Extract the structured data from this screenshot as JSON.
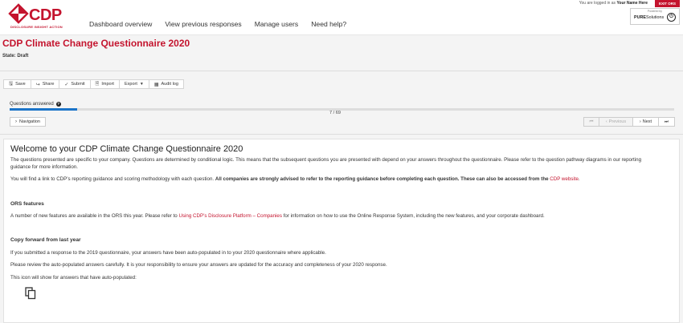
{
  "header": {
    "logo_text": "CDP",
    "logo_tagline": "DISCLOSURE INSIGHT ACTION",
    "nav": [
      "Dashboard overview",
      "View previous responses",
      "Manage users",
      "Need help?"
    ],
    "login_prefix": "You are logged in as",
    "user_name": "Your Name Here",
    "exit_label": "EXIT ORS",
    "powered_by": "Powered by",
    "powered_brand_bold": "PURE",
    "powered_brand_rest": "Solutions"
  },
  "page": {
    "title": "CDP Climate Change Questionnaire 2020",
    "state": "State: Draft"
  },
  "toolbar": {
    "save": "Save",
    "share": "Share",
    "submit": "Submit",
    "import": "Import",
    "export": "Export",
    "audit": "Audit log"
  },
  "progress": {
    "label": "Questions answered",
    "answered": 7,
    "total": 69,
    "count_text": "7 / 69"
  },
  "navigation": {
    "nav_label": "Navigation",
    "previous": "Previous",
    "next": "Next"
  },
  "content": {
    "title": "Welcome to your CDP Climate Change Questionnaire 2020",
    "intro": "The questions presented are specific to your company. Questions are determined by conditional logic. This means that the subsequent questions you are presented with depend on your answers throughout the questionnaire. Please refer to the question pathway diagrams in our reporting guidance for more information.",
    "guidance_pre": "You will find a link to CDP’s reporting guidance and scoring methodology with each question. ",
    "guidance_bold": "All companies are strongly advised to refer to the reporting guidance before completing each question. These can also be accessed from the ",
    "guidance_link": "CDP website",
    "guidance_end": ".",
    "ors_heading": "ORS features",
    "ors_pre": "A number of new features are available in the ORS this year. Please refer to ",
    "ors_link": "Using CDP’s Disclosure Platform – Companies",
    "ors_post": " for information on how to use the Online Response System, including the new features, and your corporate dashboard.",
    "copy_heading": "Copy forward from last year",
    "copy_p1": "If you submitted a response to the 2019  questionnaire, your answers have been auto-populated in to your 2020  questionnaire where applicable.",
    "copy_p2": "Please review the auto-populated answers carefully. It is your responsibility to ensure your answers are updated for the accuracy and completeness of your 2020  response.",
    "copy_p3": "This icon will show for answers that have auto-populated:"
  },
  "colors": {
    "brand": "#c4142e",
    "progress": "#1b74c8"
  },
  "icons": [
    "cdp-logo-icon",
    "save-icon",
    "share-icon",
    "check-icon",
    "import-icon",
    "caret-down-icon",
    "audit-icon",
    "help-icon",
    "chevron-right-icon",
    "first-page-icon",
    "chevron-left-icon",
    "last-page-icon",
    "copy-icon",
    "pure-logo-icon"
  ]
}
